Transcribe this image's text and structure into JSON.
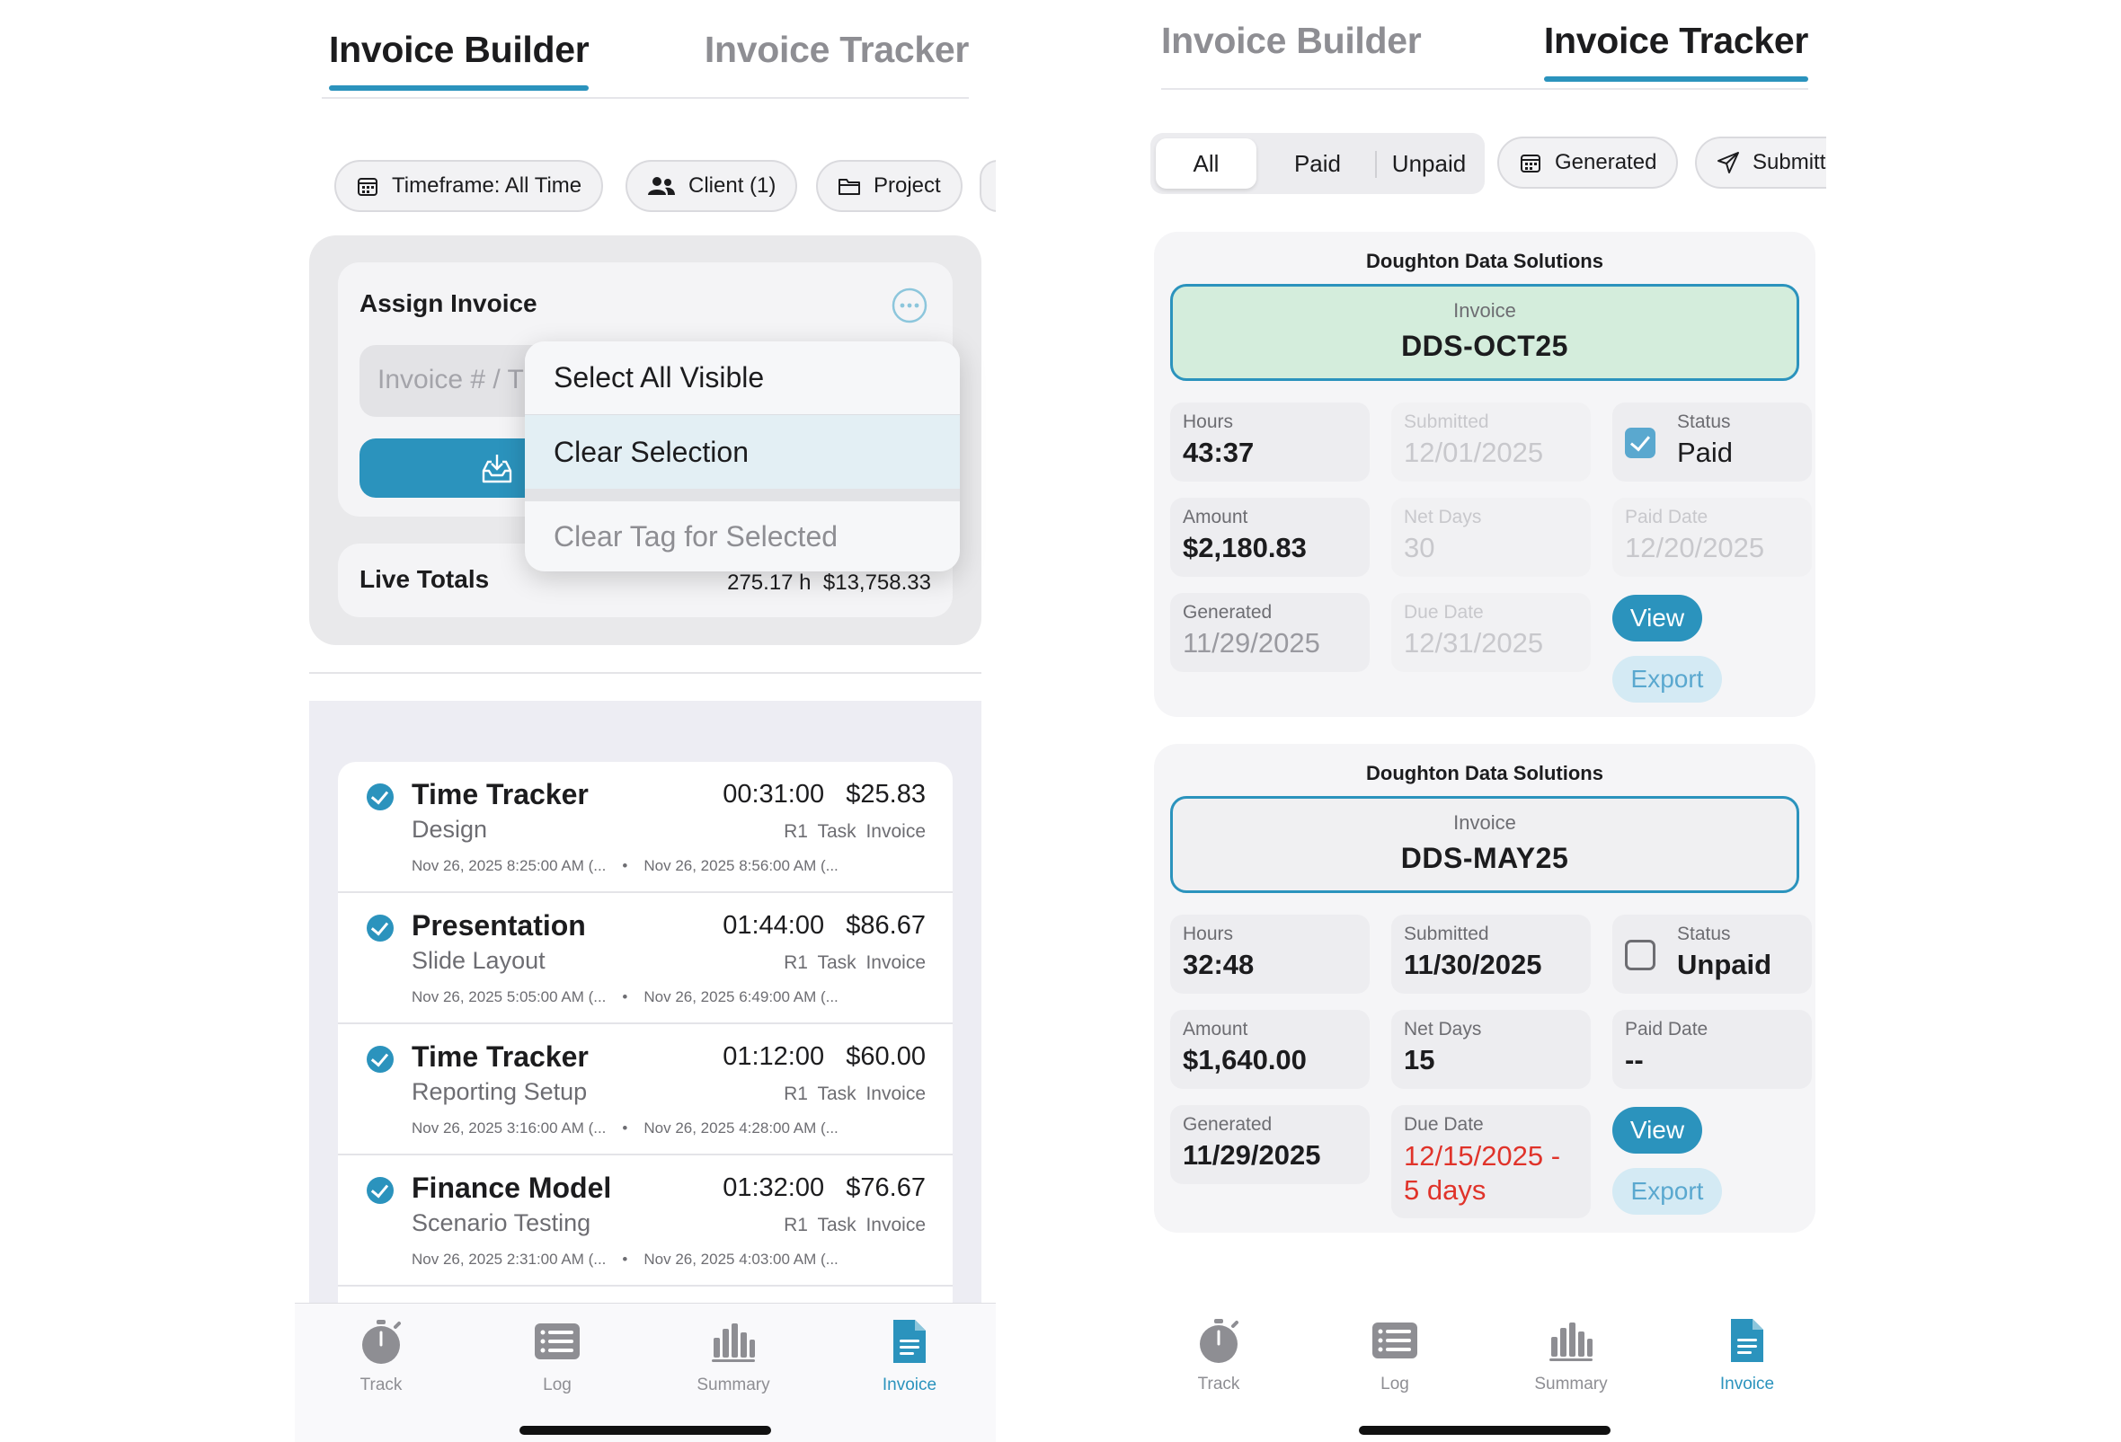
{
  "colors": {
    "accent": "#2b93bd",
    "paid_box": "#d4eddc",
    "overdue": "#e0332a"
  },
  "builder": {
    "tabs": {
      "left": "Invoice Builder",
      "right": "Invoice Tracker"
    },
    "chips": [
      {
        "icon": "calendar-icon",
        "label": "Timeframe: All Time"
      },
      {
        "icon": "people-icon",
        "label": "Client (1)"
      },
      {
        "icon": "folder-icon",
        "label": "Project"
      }
    ],
    "assign": {
      "title": "Assign Invoice",
      "placeholder": "Invoice # / T",
      "more_icon": "ellipsis-circle-icon",
      "button_icon": "tray-download-icon"
    },
    "menu": {
      "items": [
        "Select All Visible",
        "Clear Selection",
        "Clear Tag for Selected"
      ]
    },
    "live_totals": {
      "label": "Live Totals",
      "hours": "275.17 h",
      "amount": "$13,758.33"
    },
    "entries": [
      {
        "title": "Time Tracker",
        "duration": "00:31:00",
        "amount": "$25.83",
        "task": "Design",
        "tags": "R1 Task Invoice",
        "start": "Nov 26, 2025 8:25:00 AM (...",
        "end": "Nov 26, 2025 8:56:00 AM (..."
      },
      {
        "title": "Presentation",
        "duration": "01:44:00",
        "amount": "$86.67",
        "task": "Slide Layout",
        "tags": "R1 Task Invoice",
        "start": "Nov 26, 2025 5:05:00 AM (...",
        "end": "Nov 26, 2025 6:49:00 AM (..."
      },
      {
        "title": "Time Tracker",
        "duration": "01:12:00",
        "amount": "$60.00",
        "task": "Reporting Setup",
        "tags": "R1 Task Invoice",
        "start": "Nov 26, 2025 3:16:00 AM (...",
        "end": "Nov 26, 2025 4:28:00 AM (..."
      },
      {
        "title": "Finance Model",
        "duration": "01:32:00",
        "amount": "$76.67",
        "task": "Scenario Testing",
        "tags": "R1 Task Invoice",
        "start": "Nov 26, 2025 2:31:00 AM (...",
        "end": "Nov 26, 2025 4:03:00 AM (..."
      }
    ],
    "separator": "•"
  },
  "tabbar": {
    "items": [
      {
        "label": "Track",
        "icon": "stopwatch-icon"
      },
      {
        "label": "Log",
        "icon": "list-icon"
      },
      {
        "label": "Summary",
        "icon": "bar-chart-icon"
      },
      {
        "label": "Invoice",
        "icon": "document-icon"
      }
    ],
    "active": "Invoice"
  },
  "tracker": {
    "tabs": {
      "left": "Invoice Builder",
      "right": "Invoice Tracker"
    },
    "segments": [
      "All",
      "Paid",
      "Unpaid"
    ],
    "chips": [
      {
        "icon": "calendar-icon",
        "label": "Generated"
      },
      {
        "icon": "paper-plane-icon",
        "label": "Submitt"
      }
    ],
    "invoices": [
      {
        "client": "Doughton Data Solutions",
        "invoice_label": "Invoice",
        "invoice_no": "DDS-OCT25",
        "hours_label": "Hours",
        "hours": "43:37",
        "submitted_label": "Submitted",
        "submitted": "12/01/2025",
        "status_label": "Status",
        "status": "Paid",
        "amount_label": "Amount",
        "amount": "$2,180.83",
        "net_label": "Net Days",
        "net": "30",
        "paid_label": "Paid Date",
        "paid": "12/20/2025",
        "generated_label": "Generated",
        "generated": "11/29/2025",
        "due_label": "Due Date",
        "due": "12/31/2025",
        "view": "View",
        "export": "Export"
      },
      {
        "client": "Doughton Data Solutions",
        "invoice_label": "Invoice",
        "invoice_no": "DDS-MAY25",
        "hours_label": "Hours",
        "hours": "32:48",
        "submitted_label": "Submitted",
        "submitted": "11/30/2025",
        "status_label": "Status",
        "status": "Unpaid",
        "amount_label": "Amount",
        "amount": "$1,640.00",
        "net_label": "Net Days",
        "net": "15",
        "paid_label": "Paid Date",
        "paid": "--",
        "generated_label": "Generated",
        "generated": "11/29/2025",
        "due_label": "Due Date",
        "due_line1": "12/15/2025 -",
        "due_line2": "5 days",
        "view": "View",
        "export": "Export"
      }
    ]
  }
}
